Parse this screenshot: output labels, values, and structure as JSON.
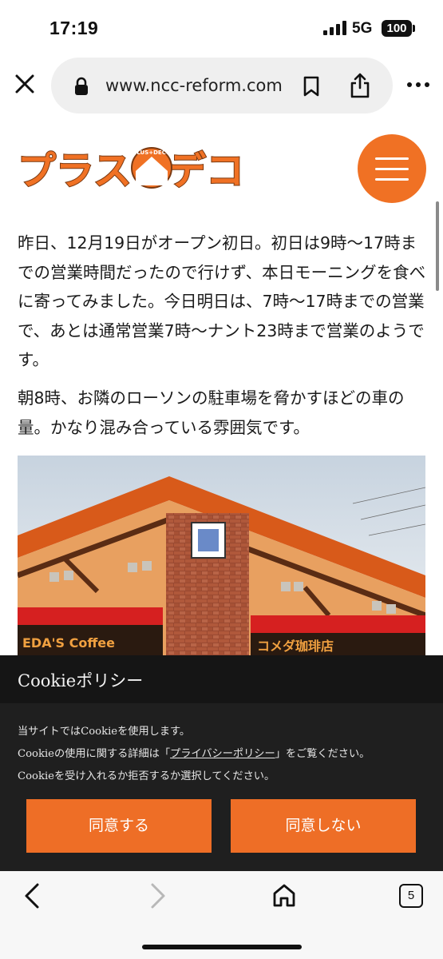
{
  "status_bar": {
    "time": "17:19",
    "network": "5G",
    "battery": "100"
  },
  "browser": {
    "url": "www.ncc-reform.com",
    "tab_count": "5"
  },
  "site": {
    "logo_text": "プラスデコ",
    "logo_sub": "PLUS+DECO",
    "brand_color": "#f07124"
  },
  "article": {
    "paragraph1": "昨日、12月19日がオープン初日。初日は9時〜17時までの営業時間だったので行けず、本日モーニングを食べに寄ってみました。今日明日は、7時〜17時までの営業で、あとは通常営業7時〜ナント23時まで営業のようです。",
    "paragraph2": "朝8時、お隣のローソンの駐車場を脅かすほどの車の量。かなり混み合っている雰囲気です。",
    "photo_sign_left": "EDA'S Coffee",
    "photo_sign_right": "コメダ珈琲店"
  },
  "cookie": {
    "title": "Cookieポリシー",
    "line1": "当サイトではCookieを使用します。",
    "line2_pre": "Cookieの使用に関する詳細は「",
    "line2_link": "プライバシーポリシー",
    "line2_post": "」をご覧ください。",
    "line3": "Cookieを受け入れるか拒否するか選択してください。",
    "agree_label": "同意する",
    "deny_label": "同意しない",
    "button_color": "#ee6e26"
  },
  "icons": [
    "close-icon",
    "lock-icon",
    "bookmark-icon",
    "share-icon",
    "more-icon",
    "hamburger-menu-icon",
    "back-icon",
    "forward-icon",
    "home-icon",
    "tabs-icon"
  ]
}
